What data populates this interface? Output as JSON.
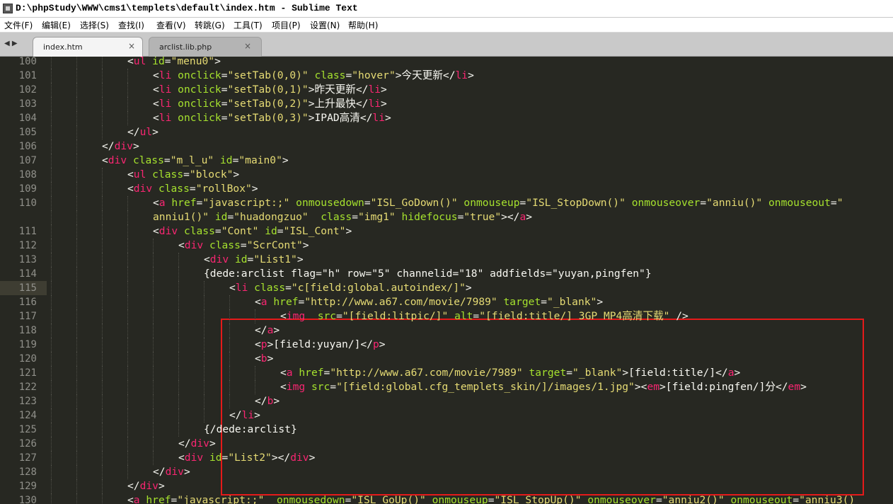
{
  "window": {
    "title": "D:\\phpStudy\\WWW\\cms1\\templets\\default\\index.htm - Sublime Text"
  },
  "menu": [
    "文件(F)",
    "编辑(E)",
    "选择(S)",
    "查找(I)",
    "查看(V)",
    "转跳(G)",
    "工具(T)",
    "项目(P)",
    "设置(N)",
    "帮助(H)"
  ],
  "nav_arrows": "◀ ▶",
  "tabs": [
    {
      "label": "index.htm",
      "active": true,
      "close": "×"
    },
    {
      "label": "arclist.lib.php",
      "active": false,
      "close": "×"
    }
  ],
  "colors": {
    "background": "#272822",
    "tag": "#f92672",
    "attribute": "#a6e22e",
    "string": "#e6db74",
    "text": "#f8f8f2",
    "line_number": "#90908a",
    "annotation_box": "#e51a1a"
  },
  "current_line": "115",
  "lines": [
    {
      "n": "100",
      "indent": 3,
      "tokens": [
        [
          "p",
          "<"
        ],
        [
          "t",
          "ul"
        ],
        [
          "p",
          " "
        ],
        [
          "a",
          "id"
        ],
        [
          "p",
          "="
        ],
        [
          "s",
          "\"menu0\""
        ],
        [
          "p",
          ">"
        ]
      ]
    },
    {
      "n": "101",
      "indent": 4,
      "tokens": [
        [
          "p",
          "<"
        ],
        [
          "t",
          "li"
        ],
        [
          "p",
          " "
        ],
        [
          "a",
          "onclick"
        ],
        [
          "p",
          "="
        ],
        [
          "s",
          "\"setTab(0,0)\""
        ],
        [
          "p",
          " "
        ],
        [
          "a",
          "class"
        ],
        [
          "p",
          "="
        ],
        [
          "s",
          "\"hover\""
        ],
        [
          "p",
          ">今天更新</"
        ],
        [
          "t",
          "li"
        ],
        [
          "p",
          ">"
        ]
      ]
    },
    {
      "n": "102",
      "indent": 4,
      "tokens": [
        [
          "p",
          "<"
        ],
        [
          "t",
          "li"
        ],
        [
          "p",
          " "
        ],
        [
          "a",
          "onclick"
        ],
        [
          "p",
          "="
        ],
        [
          "s",
          "\"setTab(0,1)\""
        ],
        [
          "p",
          ">昨天更新</"
        ],
        [
          "t",
          "li"
        ],
        [
          "p",
          ">"
        ]
      ]
    },
    {
      "n": "103",
      "indent": 4,
      "tokens": [
        [
          "p",
          "<"
        ],
        [
          "t",
          "li"
        ],
        [
          "p",
          " "
        ],
        [
          "a",
          "onclick"
        ],
        [
          "p",
          "="
        ],
        [
          "s",
          "\"setTab(0,2)\""
        ],
        [
          "p",
          ">上升最快</"
        ],
        [
          "t",
          "li"
        ],
        [
          "p",
          ">"
        ]
      ]
    },
    {
      "n": "104",
      "indent": 4,
      "tokens": [
        [
          "p",
          "<"
        ],
        [
          "t",
          "li"
        ],
        [
          "p",
          " "
        ],
        [
          "a",
          "onclick"
        ],
        [
          "p",
          "="
        ],
        [
          "s",
          "\"setTab(0,3)\""
        ],
        [
          "p",
          ">IPAD高清</"
        ],
        [
          "t",
          "li"
        ],
        [
          "p",
          ">"
        ]
      ]
    },
    {
      "n": "105",
      "indent": 3,
      "tokens": [
        [
          "p",
          "</"
        ],
        [
          "t",
          "ul"
        ],
        [
          "p",
          ">"
        ]
      ]
    },
    {
      "n": "106",
      "indent": 2,
      "tokens": [
        [
          "p",
          "</"
        ],
        [
          "t",
          "div"
        ],
        [
          "p",
          ">"
        ]
      ]
    },
    {
      "n": "107",
      "indent": 2,
      "tokens": [
        [
          "p",
          "<"
        ],
        [
          "t",
          "div"
        ],
        [
          "p",
          " "
        ],
        [
          "a",
          "class"
        ],
        [
          "p",
          "="
        ],
        [
          "s",
          "\"m_l_u\""
        ],
        [
          "p",
          " "
        ],
        [
          "a",
          "id"
        ],
        [
          "p",
          "="
        ],
        [
          "s",
          "\"main0\""
        ],
        [
          "p",
          ">"
        ]
      ]
    },
    {
      "n": "108",
      "indent": 3,
      "tokens": [
        [
          "p",
          "<"
        ],
        [
          "t",
          "ul"
        ],
        [
          "p",
          " "
        ],
        [
          "a",
          "class"
        ],
        [
          "p",
          "="
        ],
        [
          "s",
          "\"block\""
        ],
        [
          "p",
          ">"
        ]
      ]
    },
    {
      "n": "109",
      "indent": 3,
      "tokens": [
        [
          "p",
          "<"
        ],
        [
          "t",
          "div"
        ],
        [
          "p",
          " "
        ],
        [
          "a",
          "class"
        ],
        [
          "p",
          "="
        ],
        [
          "s",
          "\"rollBox\""
        ],
        [
          "p",
          ">"
        ]
      ]
    },
    {
      "n": "110",
      "indent": 4,
      "tokens": [
        [
          "p",
          "<"
        ],
        [
          "t",
          "a"
        ],
        [
          "p",
          " "
        ],
        [
          "a",
          "href"
        ],
        [
          "p",
          "="
        ],
        [
          "s",
          "\"javascript:;\""
        ],
        [
          "p",
          " "
        ],
        [
          "a",
          "onmousedown"
        ],
        [
          "p",
          "="
        ],
        [
          "s",
          "\"ISL_GoDown()\""
        ],
        [
          "p",
          " "
        ],
        [
          "a",
          "onmouseup"
        ],
        [
          "p",
          "="
        ],
        [
          "s",
          "\"ISL_StopDown()\""
        ],
        [
          "p",
          " "
        ],
        [
          "a",
          "onmouseover"
        ],
        [
          "p",
          "="
        ],
        [
          "s",
          "\"anniu()\""
        ],
        [
          "p",
          " "
        ],
        [
          "a",
          "onmouseout"
        ],
        [
          "p",
          "="
        ],
        [
          "s",
          "\""
        ]
      ]
    },
    {
      "n": "",
      "indent": 4,
      "tokens": [
        [
          "s",
          "anniu1()\""
        ],
        [
          "p",
          " "
        ],
        [
          "a",
          "id"
        ],
        [
          "p",
          "="
        ],
        [
          "s",
          "\"huadongzuo\""
        ],
        [
          "p",
          "  "
        ],
        [
          "a",
          "class"
        ],
        [
          "p",
          "="
        ],
        [
          "s",
          "\"img1\""
        ],
        [
          "p",
          " "
        ],
        [
          "a",
          "hidefocus"
        ],
        [
          "p",
          "="
        ],
        [
          "s",
          "\"true\""
        ],
        [
          "p",
          "></"
        ],
        [
          "t",
          "a"
        ],
        [
          "p",
          ">"
        ]
      ]
    },
    {
      "n": "111",
      "indent": 4,
      "tokens": [
        [
          "p",
          "<"
        ],
        [
          "t",
          "div"
        ],
        [
          "p",
          " "
        ],
        [
          "a",
          "class"
        ],
        [
          "p",
          "="
        ],
        [
          "s",
          "\"Cont\""
        ],
        [
          "p",
          " "
        ],
        [
          "a",
          "id"
        ],
        [
          "p",
          "="
        ],
        [
          "s",
          "\"ISL_Cont\""
        ],
        [
          "p",
          ">"
        ]
      ]
    },
    {
      "n": "112",
      "indent": 5,
      "tokens": [
        [
          "p",
          "<"
        ],
        [
          "t",
          "div"
        ],
        [
          "p",
          " "
        ],
        [
          "a",
          "class"
        ],
        [
          "p",
          "="
        ],
        [
          "s",
          "\"ScrCont\""
        ],
        [
          "p",
          ">"
        ]
      ]
    },
    {
      "n": "113",
      "indent": 6,
      "tokens": [
        [
          "p",
          "<"
        ],
        [
          "t",
          "div"
        ],
        [
          "p",
          " "
        ],
        [
          "a",
          "id"
        ],
        [
          "p",
          "="
        ],
        [
          "s",
          "\"List1\""
        ],
        [
          "p",
          ">"
        ]
      ]
    },
    {
      "n": "114",
      "indent": 6,
      "tokens": [
        [
          "p",
          "{dede:arclist flag=\"h\" row=\"5\" channelid=\"18\" addfields=\"yuyan,pingfen\"}"
        ]
      ]
    },
    {
      "n": "115",
      "indent": 7,
      "tokens": [
        [
          "p",
          "<"
        ],
        [
          "t",
          "li"
        ],
        [
          "p",
          " "
        ],
        [
          "a",
          "class"
        ],
        [
          "p",
          "="
        ],
        [
          "s",
          "\"c[field:global.autoindex/]\""
        ],
        [
          "p",
          ">"
        ]
      ]
    },
    {
      "n": "116",
      "indent": 8,
      "tokens": [
        [
          "p",
          "<"
        ],
        [
          "t",
          "a"
        ],
        [
          "p",
          " "
        ],
        [
          "a",
          "href"
        ],
        [
          "p",
          "="
        ],
        [
          "s",
          "\"http://www.a67.com/movie/7989\""
        ],
        [
          "p",
          " "
        ],
        [
          "a",
          "target"
        ],
        [
          "p",
          "="
        ],
        [
          "s",
          "\"_blank\""
        ],
        [
          "p",
          ">"
        ]
      ]
    },
    {
      "n": "117",
      "indent": 9,
      "tokens": [
        [
          "p",
          "<"
        ],
        [
          "t",
          "img"
        ],
        [
          "p",
          "  "
        ],
        [
          "a",
          "src"
        ],
        [
          "p",
          "="
        ],
        [
          "s",
          "\"[field:litpic/]\""
        ],
        [
          "p",
          " "
        ],
        [
          "a",
          "alt"
        ],
        [
          "p",
          "="
        ],
        [
          "s",
          "\"[field:title/] 3GP MP4高清下载\""
        ],
        [
          "p",
          " />"
        ]
      ]
    },
    {
      "n": "118",
      "indent": 8,
      "tokens": [
        [
          "p",
          "</"
        ],
        [
          "t",
          "a"
        ],
        [
          "p",
          ">"
        ]
      ]
    },
    {
      "n": "119",
      "indent": 8,
      "tokens": [
        [
          "p",
          "<"
        ],
        [
          "t",
          "p"
        ],
        [
          "p",
          ">[field:yuyan/]</"
        ],
        [
          "t",
          "p"
        ],
        [
          "p",
          ">"
        ]
      ]
    },
    {
      "n": "120",
      "indent": 8,
      "tokens": [
        [
          "p",
          "<"
        ],
        [
          "t",
          "b"
        ],
        [
          "p",
          ">"
        ]
      ]
    },
    {
      "n": "121",
      "indent": 9,
      "tokens": [
        [
          "p",
          "<"
        ],
        [
          "t",
          "a"
        ],
        [
          "p",
          " "
        ],
        [
          "a",
          "href"
        ],
        [
          "p",
          "="
        ],
        [
          "s",
          "\"http://www.a67.com/movie/7989\""
        ],
        [
          "p",
          " "
        ],
        [
          "a",
          "target"
        ],
        [
          "p",
          "="
        ],
        [
          "s",
          "\"_blank\""
        ],
        [
          "p",
          ">[field:title/]</"
        ],
        [
          "t",
          "a"
        ],
        [
          "p",
          ">"
        ]
      ]
    },
    {
      "n": "122",
      "indent": 9,
      "tokens": [
        [
          "p",
          "<"
        ],
        [
          "t",
          "img"
        ],
        [
          "p",
          " "
        ],
        [
          "a",
          "src"
        ],
        [
          "p",
          "="
        ],
        [
          "s",
          "\"[field:global.cfg_templets_skin/]/images/1.jpg\""
        ],
        [
          "p",
          "><"
        ],
        [
          "t",
          "em"
        ],
        [
          "p",
          ">[field:pingfen/]分</"
        ],
        [
          "t",
          "em"
        ],
        [
          "p",
          ">"
        ]
      ]
    },
    {
      "n": "123",
      "indent": 8,
      "tokens": [
        [
          "p",
          "</"
        ],
        [
          "t",
          "b"
        ],
        [
          "p",
          ">"
        ]
      ]
    },
    {
      "n": "124",
      "indent": 7,
      "tokens": [
        [
          "p",
          "</"
        ],
        [
          "t",
          "li"
        ],
        [
          "p",
          ">"
        ]
      ]
    },
    {
      "n": "125",
      "indent": 6,
      "tokens": [
        [
          "p",
          "{/dede:arclist}"
        ]
      ]
    },
    {
      "n": "126",
      "indent": 5,
      "tokens": [
        [
          "p",
          "</"
        ],
        [
          "t",
          "div"
        ],
        [
          "p",
          ">"
        ]
      ]
    },
    {
      "n": "127",
      "indent": 5,
      "tokens": [
        [
          "p",
          "<"
        ],
        [
          "t",
          "div"
        ],
        [
          "p",
          " "
        ],
        [
          "a",
          "id"
        ],
        [
          "p",
          "="
        ],
        [
          "s",
          "\"List2\""
        ],
        [
          "p",
          "></"
        ],
        [
          "t",
          "div"
        ],
        [
          "p",
          ">"
        ]
      ]
    },
    {
      "n": "128",
      "indent": 4,
      "tokens": [
        [
          "p",
          "</"
        ],
        [
          "t",
          "div"
        ],
        [
          "p",
          ">"
        ]
      ]
    },
    {
      "n": "129",
      "indent": 3,
      "tokens": [
        [
          "p",
          "</"
        ],
        [
          "t",
          "div"
        ],
        [
          "p",
          ">"
        ]
      ]
    },
    {
      "n": "130",
      "indent": 3,
      "tokens": [
        [
          "p",
          "<"
        ],
        [
          "t",
          "a"
        ],
        [
          "p",
          " "
        ],
        [
          "a",
          "href"
        ],
        [
          "p",
          "="
        ],
        [
          "s",
          "\"javascript:;\""
        ],
        [
          "p",
          "  "
        ],
        [
          "a",
          "onmousedown"
        ],
        [
          "p",
          "="
        ],
        [
          "s",
          "\"ISL_GoUp()\""
        ],
        [
          "p",
          " "
        ],
        [
          "a",
          "onmouseup"
        ],
        [
          "p",
          "="
        ],
        [
          "s",
          "\"ISL_StopUp()\""
        ],
        [
          "p",
          " "
        ],
        [
          "a",
          "onmouseover"
        ],
        [
          "p",
          "="
        ],
        [
          "s",
          "\"anniu2()\""
        ],
        [
          "p",
          " "
        ],
        [
          "a",
          "onmouseout"
        ],
        [
          "p",
          "="
        ],
        [
          "s",
          "\"anniu3()"
        ]
      ]
    }
  ]
}
